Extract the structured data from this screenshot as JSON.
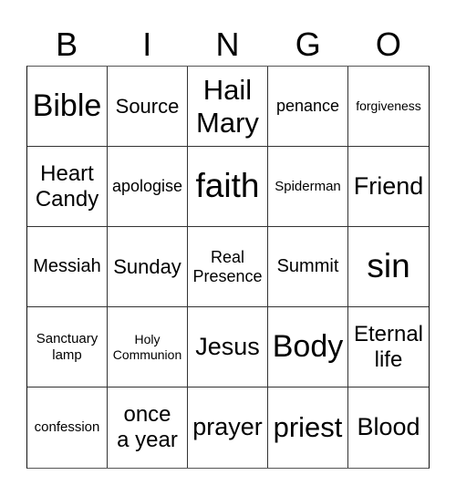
{
  "header": {
    "letters": [
      "B",
      "I",
      "N",
      "G",
      "O"
    ]
  },
  "card": {
    "rows": [
      [
        {
          "text": "Bible",
          "size": "xl"
        },
        {
          "text": "Source",
          "size": "m"
        },
        {
          "text": "Hail\nMary",
          "size": "l"
        },
        {
          "text": "penance",
          "size": "s"
        },
        {
          "text": "forgiveness",
          "size": "xxs"
        }
      ],
      [
        {
          "text": "Heart\nCandy",
          "size": "ml"
        },
        {
          "text": "apologise",
          "size": "s"
        },
        {
          "text": "faith",
          "size": "xxl"
        },
        {
          "text": "Spiderman",
          "size": "xs"
        },
        {
          "text": "Friend",
          "size": "lm"
        }
      ],
      [
        {
          "text": "Messiah",
          "size": "sm"
        },
        {
          "text": "Sunday",
          "size": "m"
        },
        {
          "text": "Real\nPresence",
          "size": "s"
        },
        {
          "text": "Summit",
          "size": "sm"
        },
        {
          "text": "sin",
          "size": "xxl"
        }
      ],
      [
        {
          "text": "Sanctuary\nlamp",
          "size": "xs"
        },
        {
          "text": "Holy\nCommunion",
          "size": "xxs"
        },
        {
          "text": "Jesus",
          "size": "lm"
        },
        {
          "text": "Body",
          "size": "xl"
        },
        {
          "text": "Eternal\nlife",
          "size": "ml"
        }
      ],
      [
        {
          "text": "confession",
          "size": "xs"
        },
        {
          "text": "once\na year",
          "size": "ml"
        },
        {
          "text": "prayer",
          "size": "lm"
        },
        {
          "text": "priest",
          "size": "l"
        },
        {
          "text": "Blood",
          "size": "lm"
        }
      ]
    ]
  }
}
